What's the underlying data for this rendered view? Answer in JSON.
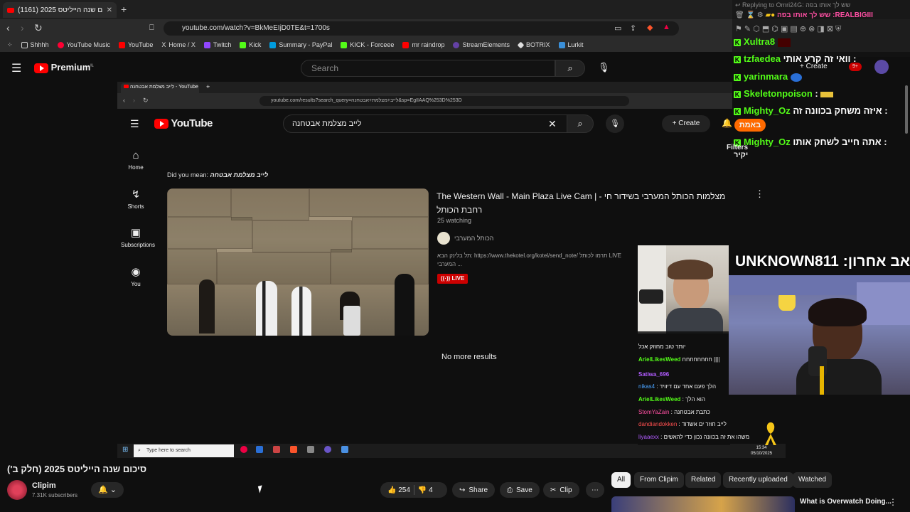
{
  "browser": {
    "tab_title": "(1161) סיכום שנה הייליטס 2025",
    "url": "youtube.com/watch?v=BkMeEIjD0TE&t=1700s",
    "bookmarks": [
      "Shhhh",
      "YouTube Music",
      "YouTube",
      "Home / X",
      "Twitch",
      "Kick",
      "Summary - PayPal",
      "KICK - Forceee",
      "mr raindrop",
      "StreamElements",
      "BOTRIX",
      "Lurkit"
    ]
  },
  "header": {
    "premium_label": "Premium",
    "region": "IL",
    "search_placeholder": "Search"
  },
  "inner": {
    "tab_title": "לייב מצלמת אבטחנה - YouTube",
    "url": "youtube.com/results?search_query=לייב+מצלמת+אבטחנה&sp=EgIIAAQ%253D%253D",
    "logo": "YouTube",
    "search_value": "לייב מצלמת אבטחנה",
    "create": "Create",
    "filters": "Filters",
    "nav": [
      "Home",
      "Shorts",
      "Subscriptions",
      "You"
    ],
    "did_you_mean_label": "Did you mean:",
    "did_you_mean_value": "לייב מצלמת אבטחה",
    "result": {
      "title": "The Western Wall - Main Plaza Live Cam | - מצלמות הכותל המערבי בשידור חי רחבת הכותל",
      "watching": "25 watching",
      "channel": "הכותל המערבי",
      "desc": "תל בלינק הבא: https://www.thekotel.org/kotel/send_note/ תרמו לכותל LIVE המערבי ...",
      "live_badge": "LIVE"
    },
    "no_more": "No more results",
    "taskbar_search": "Type here to search",
    "time": "15:34",
    "date": "05/10/2025"
  },
  "chat": {
    "reply_header": "Replying to Omri24G: שש לך אותו בפה",
    "top_line": "שש לך אותו בפה :REALBIGIII",
    "lines": [
      {
        "user": "Xultra8",
        "msg": ""
      },
      {
        "user": "tzfaedea",
        "msg": "וואי זה קרע אותי :"
      },
      {
        "user": "yarinmara",
        "msg": ""
      },
      {
        "user": "Skeletonpoison",
        "msg": ":"
      },
      {
        "user": "Mighty_Oz",
        "msg": "איזה משחק בכוונה זה :"
      },
      {
        "user": "Mighty_Oz",
        "msg": "אתה חייב לשחק אותו :"
      }
    ],
    "badge_text": "באמת",
    "extra_word": "יקיר",
    "user_colors": {
      "default": "#53fc18"
    }
  },
  "overlay": {
    "unknown_banner": "UNKNOWN811 :אב אחרון"
  },
  "small_chat": [
    {
      "user": "",
      "msg": "יותר טוב מחוזק אכל",
      "color": "#ffffff"
    },
    {
      "user": "ArielLikesWeed",
      "msg": "חחחחחחחח ||||",
      "color": "#53fc18"
    },
    {
      "user": "Satiwa_696",
      "msg": "",
      "color": "#b15cff"
    },
    {
      "user": "nikas4",
      "msg": "הלך פעם אחד עם דיוויד",
      "color": "#4aa3ff"
    },
    {
      "user": "ArielLikesWeed",
      "msg": "הוא הלך",
      "color": "#53fc18"
    },
    {
      "user": "StomYaZain",
      "msg": "כתבת אבטחנה",
      "color": "#ff4fa3"
    },
    {
      "user": "dandiandokken",
      "msg": "לייב חוזר ים אשדוד",
      "color": "#ff4f4f"
    },
    {
      "user": "liyaaexx",
      "msg": "משהו את זה בכוונה נכון כדי להאשים",
      "color": "#b15cff"
    }
  ],
  "video_page": {
    "title": "סיכום שנה הייליטס 2025 (חלק ב')",
    "channel": "Clipim",
    "subscribers": "7.31K subscribers",
    "likes": "254",
    "dislikes": "4",
    "share": "Share",
    "save": "Save",
    "clip": "Clip",
    "chips": [
      "All",
      "From Clipim",
      "Related",
      "Recently uploaded",
      "Watched"
    ],
    "next_title": "What is Overwatch Doing..."
  }
}
